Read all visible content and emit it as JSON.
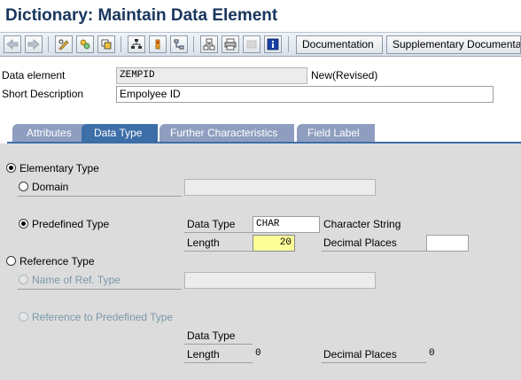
{
  "window": {
    "title": "Dictionary: Maintain Data Element"
  },
  "toolbar": {
    "documentation_label": "Documentation",
    "supplementary_label": "Supplementary Documentati"
  },
  "header_fields": {
    "data_element_label": "Data element",
    "data_element_value": "ZEMPID",
    "status_text": "New(Revised)",
    "short_desc_label": "Short Description",
    "short_desc_value": "Empolyee ID"
  },
  "tabs": [
    {
      "label": "Attributes"
    },
    {
      "label": "Data Type"
    },
    {
      "label": "Further Characteristics"
    },
    {
      "label": "Field Label"
    }
  ],
  "data_type_tab": {
    "elementary_type_label": "Elementary Type",
    "domain_label": "Domain",
    "domain_value": "",
    "predefined_type_label": "Predefined Type",
    "pt_data_type_label": "Data Type",
    "pt_data_type_value": "CHAR",
    "pt_data_type_desc": "Character String",
    "pt_length_label": "Length",
    "pt_length_value": "20",
    "pt_decimal_label": "Decimal Places",
    "pt_decimal_value": "",
    "reference_type_label": "Reference Type",
    "name_of_ref_type_label": "Name of Ref. Type",
    "name_of_ref_type_value": "",
    "ref_to_predefined_label": "Reference to Predefined Type",
    "rp_data_type_label": "Data Type",
    "rp_length_label": "Length",
    "rp_length_value": "0",
    "rp_decimal_label": "Decimal Places",
    "rp_decimal_value": "0"
  },
  "selection": {
    "elementary_type": true,
    "domain": false,
    "predefined_type": true,
    "reference_type": false
  }
}
